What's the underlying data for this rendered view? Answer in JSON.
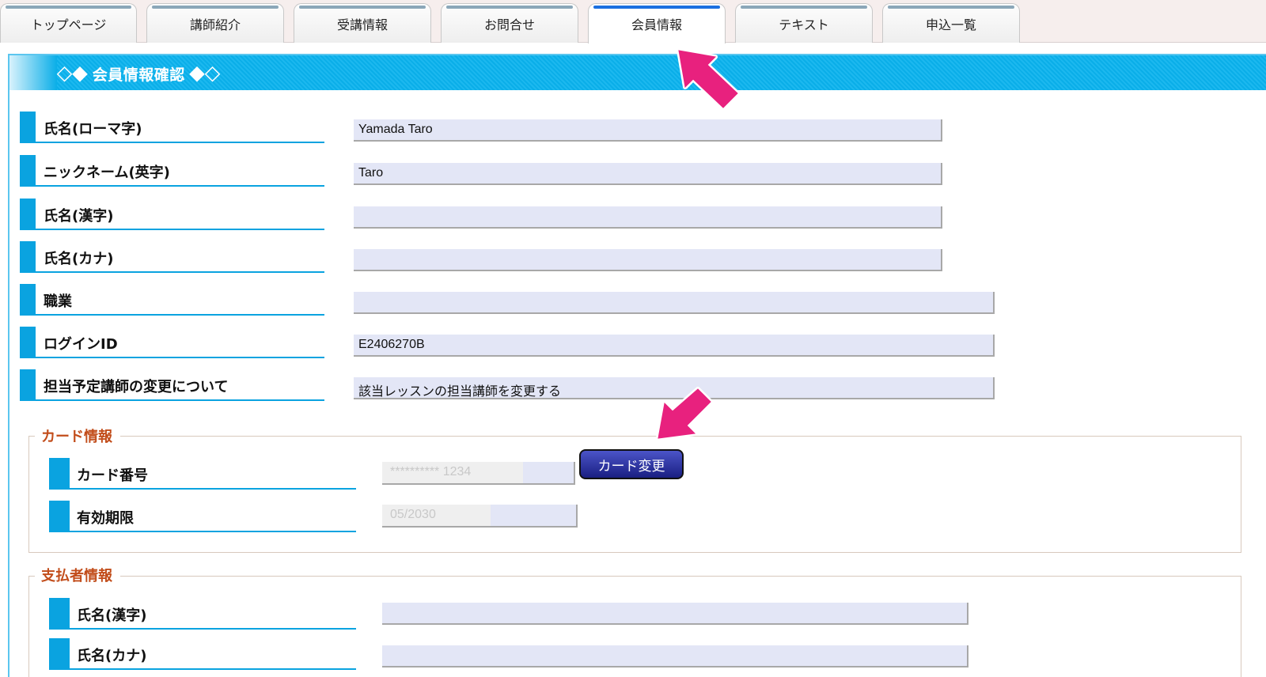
{
  "tabs": [
    {
      "label": "トップページ"
    },
    {
      "label": "講師紹介"
    },
    {
      "label": "受講情報"
    },
    {
      "label": "お問合せ"
    },
    {
      "label": "会員情報"
    },
    {
      "label": "テキスト"
    },
    {
      "label": "申込一覧"
    }
  ],
  "active_tab_index": 4,
  "panel": {
    "title": "◇◆ 会員情報確認 ◆◇"
  },
  "member_fields": [
    {
      "label": "氏名(ローマ字)",
      "value": "Yamada Taro"
    },
    {
      "label": "ニックネーム(英字)",
      "value": "Taro"
    },
    {
      "label": "氏名(漢字)",
      "value": ""
    },
    {
      "label": "氏名(カナ)",
      "value": ""
    },
    {
      "label": "職業",
      "value": ""
    },
    {
      "label": "ログインID",
      "value": "E2406270B"
    },
    {
      "label": "担当予定講師の変更について",
      "value": "該当レッスンの担当講師を変更する"
    }
  ],
  "card_section": {
    "title": "カード情報",
    "card_number_label": "カード番号",
    "card_number_value": "********** 1234",
    "expiry_label": "有効期限",
    "expiry_value": "05/2030",
    "change_button": "カード変更"
  },
  "payer_section": {
    "title": "支払者情報",
    "name_kanji_label": "氏名(漢字)",
    "name_kanji_value": "",
    "name_kana_label": "氏名(カナ)",
    "name_kana_value": ""
  },
  "colors": {
    "accent": "#0aa3e0",
    "header_blue": "#0aaee8",
    "section_title": "#c24d1b",
    "field_bg": "#e3e6f6",
    "pointer_arrow": "#e8217e"
  }
}
